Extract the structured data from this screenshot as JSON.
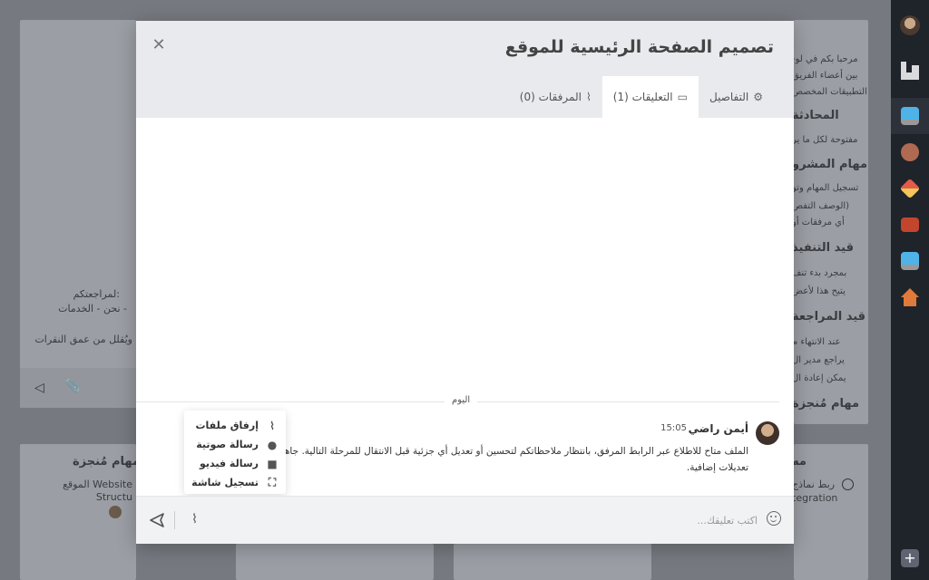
{
  "modal": {
    "title": "تصميم الصفحة الرئيسية للموقع",
    "close_icon": "close-icon",
    "tabs": [
      {
        "label": "التفاصيل",
        "icon": "gear-icon"
      },
      {
        "label": "التعليقات (1)",
        "icon": "comment-icon"
      },
      {
        "label": "المرفقات (0)",
        "icon": "paperclip-icon"
      }
    ],
    "active_tab": 1,
    "divider_label": "اليوم",
    "comment": {
      "author": "أيمن راضي",
      "time": "15:05",
      "text": "الملف متاح للاطلاع عبر الرابط المرفق، بانتظار ملاحظاتكم لتحسين أو تعديل أي جزئية قبل الانتقال للمرحلة التالية. جاهز لأي تعديلات إضافية."
    },
    "attach_menu": [
      {
        "label": "إرفاق ملفات",
        "icon": "paperclip-icon"
      },
      {
        "label": "رسالة صوتية",
        "icon": "microphone-icon"
      },
      {
        "label": "رسالة فيديو",
        "icon": "video-camera-icon"
      },
      {
        "label": "تسجيل شاشة",
        "icon": "screen-record-icon"
      }
    ],
    "input_placeholder": "اكتب تعليقك..."
  },
  "background": {
    "right_card": {
      "intro_1": "مرحبا بكم في لو-",
      "intro_2": "بين أعضاء الفريق",
      "intro_3": "التطبيقات المخصص",
      "h1": "المحادثة",
      "p1": "مفتوحة لكل ما ير",
      "h2": "مهام المشرو",
      "p2": "تسجيل المهام وتو",
      "b1": "(الوصف التفص",
      "b2": "أي مرفقات أو",
      "h3": "قيد التنفيذ",
      "b3": "بمجرد بدء تنف",
      "b4": "يتيح هذا لأعض",
      "h4": "قيد المراجعة",
      "b5": "عند الانتهاء م",
      "b6": "يراجع مدير ال",
      "b7": "يمكن إعادة ال",
      "h5": "مهام مُنجزة"
    },
    "left_card": {
      "l1": "لمراجعتكم:",
      "l2": "نحن - الخدمات -",
      "l3": "ويُقلل من عمق النقرات"
    },
    "bottom_left": {
      "title": "مهام مُنجزة",
      "l1": "الموقع Website",
      "l2": "Structu"
    },
    "bottom_right": {
      "title": "مه",
      "l1": "ربط نماذج",
      "l2": "tegration"
    }
  }
}
